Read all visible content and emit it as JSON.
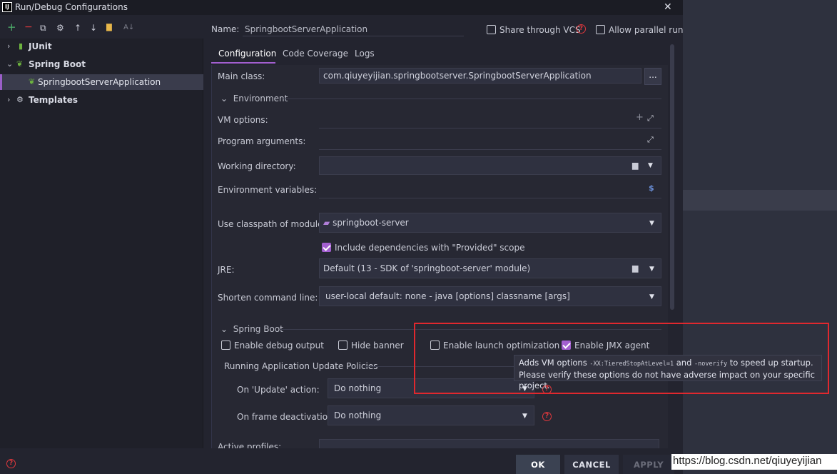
{
  "window": {
    "title": "Run/Debug Configurations",
    "logo_text": "IJ",
    "close_glyph": "✕"
  },
  "toolbar": {
    "add": "+",
    "remove": "−",
    "copy": "⧉",
    "settings": "⚙",
    "up": "↑",
    "down": "↓",
    "folder": "▇",
    "sort": "A↓"
  },
  "tree": {
    "items": [
      {
        "label": "JUnit",
        "icon": "junit-icon",
        "level": 0,
        "expanded": false
      },
      {
        "label": "Spring Boot",
        "icon": "spring-boot-icon",
        "level": 0,
        "expanded": true
      },
      {
        "label": "SpringbootServerApplication",
        "icon": "spring-boot-icon",
        "level": 1,
        "selected": true
      },
      {
        "label": "Templates",
        "icon": "wrench-icon",
        "level": 0,
        "expanded": false
      }
    ]
  },
  "header": {
    "name_label": "Name:",
    "name_value": "SpringbootServerApplication",
    "share_label": "Share through VCS",
    "share_checked": false,
    "parallel_label": "Allow parallel run",
    "parallel_checked": false
  },
  "tabs": [
    {
      "label": "Configuration",
      "active": true
    },
    {
      "label": "Code Coverage",
      "active": false
    },
    {
      "label": "Logs",
      "active": false
    }
  ],
  "form": {
    "main_class_label": "Main class:",
    "main_class_value": "com.qiuyeyijian.springbootserver.SpringbootServerApplication",
    "ellipsis": "...",
    "environment_section": "Environment",
    "vm_options_label": "VM options:",
    "program_args_label": "Program arguments:",
    "working_dir_label": "Working directory:",
    "env_vars_label": "Environment variables:",
    "env_vars_icon": "$",
    "classpath_label": "Use classpath of module:",
    "classpath_value": "springboot-server",
    "include_deps_label": "Include dependencies with \"Provided\" scope",
    "include_deps_checked": true,
    "jre_label": "JRE:",
    "jre_value": "Default (13 - SDK of 'springboot-server' module)",
    "shorten_label": "Shorten command line:",
    "shorten_value": "user-local default: none - java [options] classname [args]",
    "spring_section": "Spring Boot",
    "debug_output_label": "Enable debug output",
    "debug_output_checked": false,
    "hide_banner_label": "Hide banner",
    "hide_banner_checked": false,
    "launch_opt_label": "Enable launch optimization",
    "launch_opt_checked": false,
    "jmx_label": "Enable JMX agent",
    "jmx_checked": true,
    "update_policies_label": "Running Application Update Policies",
    "on_update_label": "On 'Update' action:",
    "on_update_value": "Do nothing",
    "on_frame_label": "On frame deactivation:",
    "on_frame_value": "Do nothing",
    "active_profiles_label": "Active profiles:"
  },
  "tooltip": {
    "prefix": "Adds VM options ",
    "opt1": "-XX:TieredStopAtLevel=1",
    "middle": " and ",
    "opt2": "-noverify",
    "suffix": " to speed up startup.",
    "line2": "Please verify these options do not have adverse impact on your specific project."
  },
  "buttons": {
    "ok": "OK",
    "cancel": "CANCEL",
    "apply": "APPLY"
  },
  "watermark": "https://blog.csdn.net/qiuyeyijian",
  "colors": {
    "accent": "#a35fd0",
    "help": "#e0383d",
    "highlight_box": "#e0282e",
    "spring": "#6db33f"
  }
}
